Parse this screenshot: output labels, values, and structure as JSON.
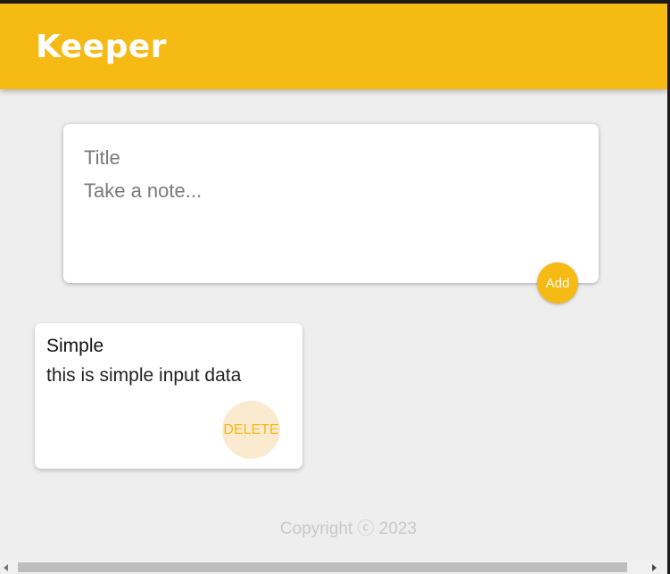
{
  "header": {
    "title": "Keeper",
    "background": "#f5ba13"
  },
  "create_area": {
    "title_placeholder": "Title",
    "content_placeholder": "Take a note...",
    "add_label": "Add"
  },
  "notes": [
    {
      "title": "Simple",
      "content": "this is simple input data",
      "delete_label": "DELETE"
    }
  ],
  "footer": {
    "copyright": "Copyright ⓒ 2023"
  },
  "colors": {
    "accent": "#f5ba13",
    "page_bg": "#eeeeee",
    "card_bg": "#ffffff"
  }
}
